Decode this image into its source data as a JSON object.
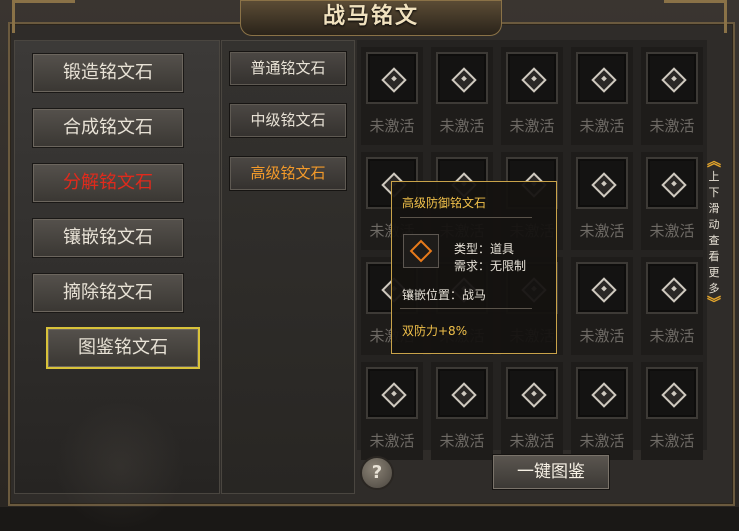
{
  "window": {
    "title": "战马铭文"
  },
  "menu": {
    "items": [
      {
        "label": "锻造铭文石",
        "state": "normal"
      },
      {
        "label": "合成铭文石",
        "state": "normal"
      },
      {
        "label": "分解铭文石",
        "state": "active"
      },
      {
        "label": "镶嵌铭文石",
        "state": "normal"
      },
      {
        "label": "摘除铭文石",
        "state": "normal"
      },
      {
        "label": "图鉴铭文石",
        "state": "selected"
      }
    ]
  },
  "tiers": {
    "items": [
      {
        "label": "普通铭文石"
      },
      {
        "label": "中级铭文石"
      },
      {
        "label": "高级铭文石",
        "active": true
      }
    ]
  },
  "grid": {
    "slot_label": "未激活",
    "rows": 4,
    "cols": 5
  },
  "tooltip": {
    "title": "高级防御铭文石",
    "type_label": "类型：道具",
    "requirement_label": "需求：无限制",
    "position_label": "镶嵌位置：战马",
    "bonus": "双防力+8%"
  },
  "scroll": {
    "hint_chars": [
      "上",
      "下",
      "滑",
      "动",
      "查",
      "看",
      "更",
      "多"
    ]
  },
  "actions": {
    "help": "?",
    "one_click": "一键图鉴"
  },
  "colors": {
    "accent_gold": "#f0c04a",
    "active_red": "#e02a1c",
    "active_orange": "#f39a2a",
    "selected_border": "#d8c23a"
  }
}
